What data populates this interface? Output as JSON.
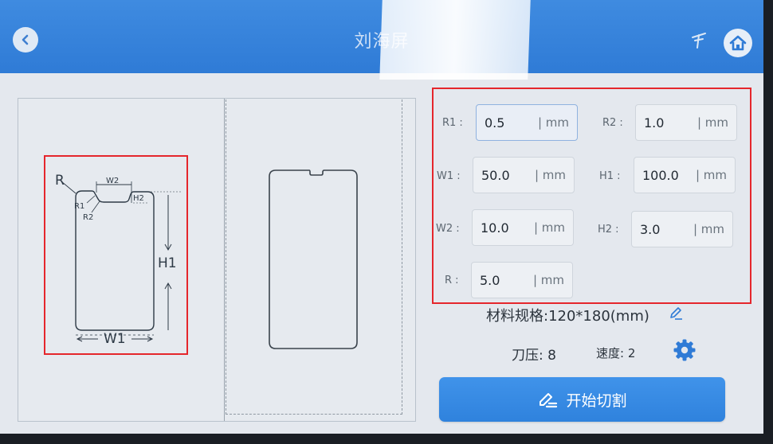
{
  "header": {
    "title": "刘海屏"
  },
  "diagram": {
    "labels": {
      "r": "R",
      "w2": "W2",
      "h2": "H2",
      "r1": "R1",
      "r2": "R2",
      "h1": "H1",
      "w1": "W1"
    }
  },
  "params": [
    {
      "label": "R1 :",
      "value": "0.5",
      "unit": "| mm"
    },
    {
      "label": "R2 :",
      "value": "1.0",
      "unit": "| mm"
    },
    {
      "label": "W1 :",
      "value": "50.0",
      "unit": "| mm"
    },
    {
      "label": "H1 :",
      "value": "100.0",
      "unit": "| mm"
    },
    {
      "label": "W2 :",
      "value": "10.0",
      "unit": "| mm"
    },
    {
      "label": "H2 :",
      "value": "3.0",
      "unit": "| mm"
    },
    {
      "label": "R :",
      "value": "5.0",
      "unit": "| mm"
    }
  ],
  "material": {
    "spec_text": "材料规格:120*180(mm)"
  },
  "blade": {
    "pressure_text": "刀压: 8",
    "speed_text": "速度: 2"
  },
  "actions": {
    "start_label": "开始切割"
  },
  "colors": {
    "accent": "#2f7bd6",
    "highlight_border": "#e5262c"
  }
}
